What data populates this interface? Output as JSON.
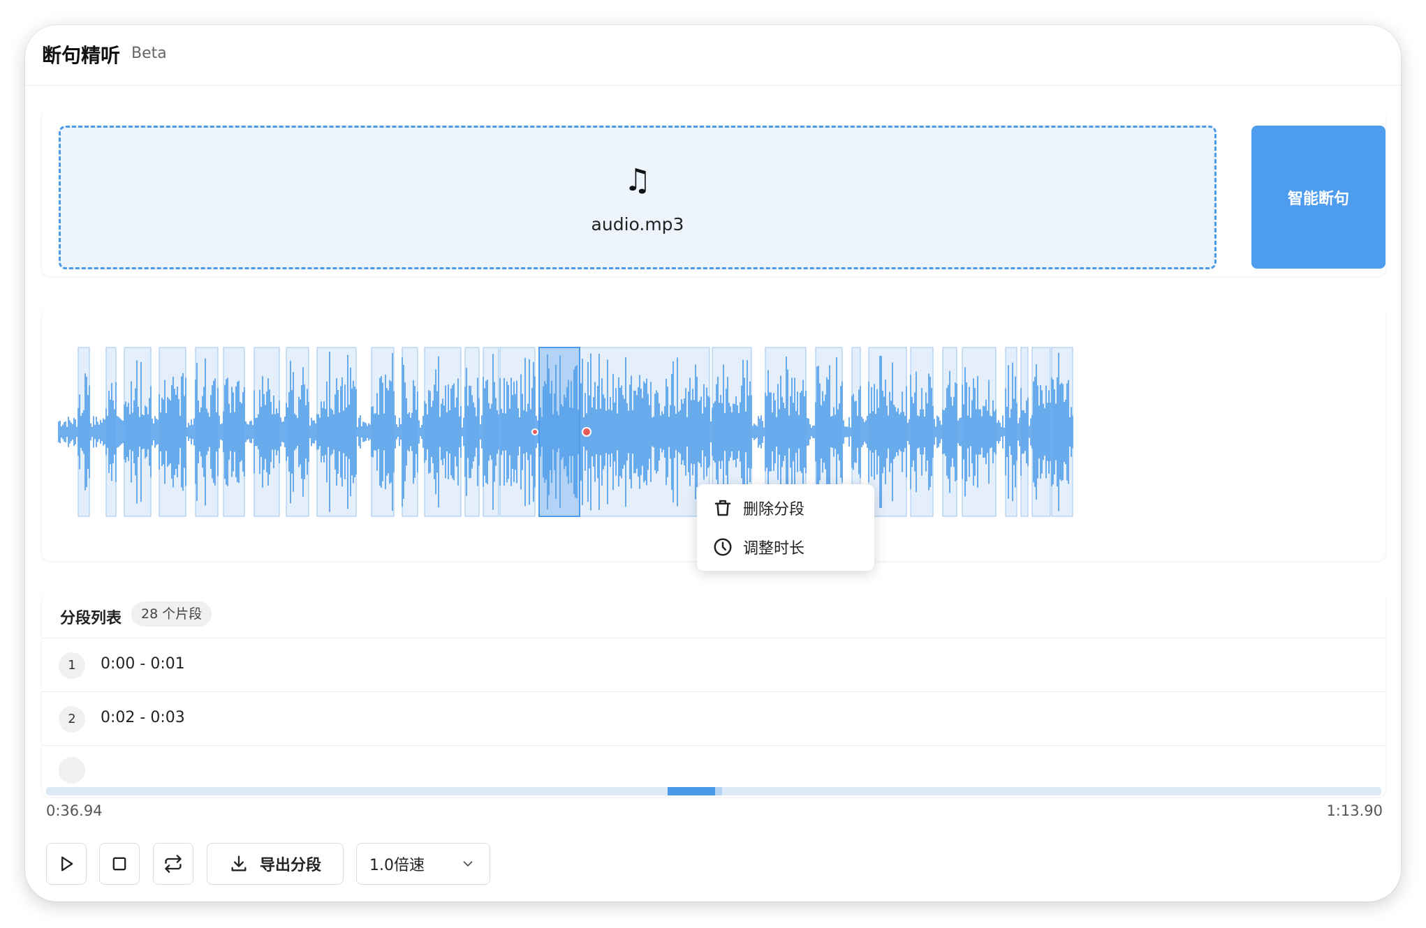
{
  "header": {
    "title": "断句精听",
    "beta": "Beta"
  },
  "upload": {
    "music_icon": "♫",
    "filename": "audio.mp3",
    "smart_button": "智能断句"
  },
  "context_menu": {
    "delete_label": "删除分段",
    "adjust_label": "调整时长"
  },
  "segments": {
    "title": "分段列表",
    "count": "28 个片段",
    "rows": [
      {
        "index": "1",
        "range": "0:00 - 0:01"
      },
      {
        "index": "2",
        "range": "0:02 - 0:03"
      }
    ]
  },
  "player": {
    "current_time": "0:36.94",
    "total_time": "1:13.90",
    "export_label": "导出分段",
    "speed_label": "1.0倍速"
  },
  "colors": {
    "accent": "#4a9ae9",
    "segment_fill": "#e4effb",
    "selected_fill": "#b3d3f6",
    "marker": "#e85a5a"
  }
}
